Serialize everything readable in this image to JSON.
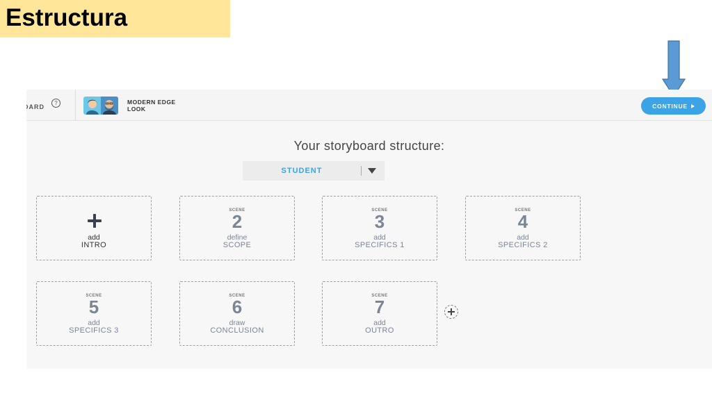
{
  "slide": {
    "title": "Estructura"
  },
  "toolbar": {
    "board_label": "BOARD",
    "help_symbol": "?",
    "look_line1": "MODERN EDGE",
    "look_line2": "LOOK",
    "continue_label": "CONTINUE"
  },
  "structure": {
    "heading": "Your storyboard structure:",
    "selected": "STUDENT"
  },
  "scene_tag": "SCENE",
  "scenes": [
    {
      "verb": "add",
      "name": "INTRO"
    },
    {
      "number": "2",
      "verb": "define",
      "name": "SCOPE"
    },
    {
      "number": "3",
      "verb": "add",
      "name": "SPECIFICS 1"
    },
    {
      "number": "4",
      "verb": "add",
      "name": "SPECIFICS 2"
    },
    {
      "number": "5",
      "verb": "add",
      "name": "SPECIFICS 3"
    },
    {
      "number": "6",
      "verb": "draw",
      "name": "CONCLUSION"
    },
    {
      "number": "7",
      "verb": "add",
      "name": "OUTRO"
    }
  ],
  "icons": {
    "help": "help-icon",
    "continue": "play-icon",
    "dropdown": "caret-down-icon",
    "intro_add": "plus-icon",
    "add_scene": "add-circle-icon",
    "callout": "arrow-down-icon"
  },
  "colors": {
    "title_bg": "#ffe699",
    "accent": "#3ba3e6",
    "arrow": "#5b9bd5",
    "scene_text": "#7a8596"
  }
}
